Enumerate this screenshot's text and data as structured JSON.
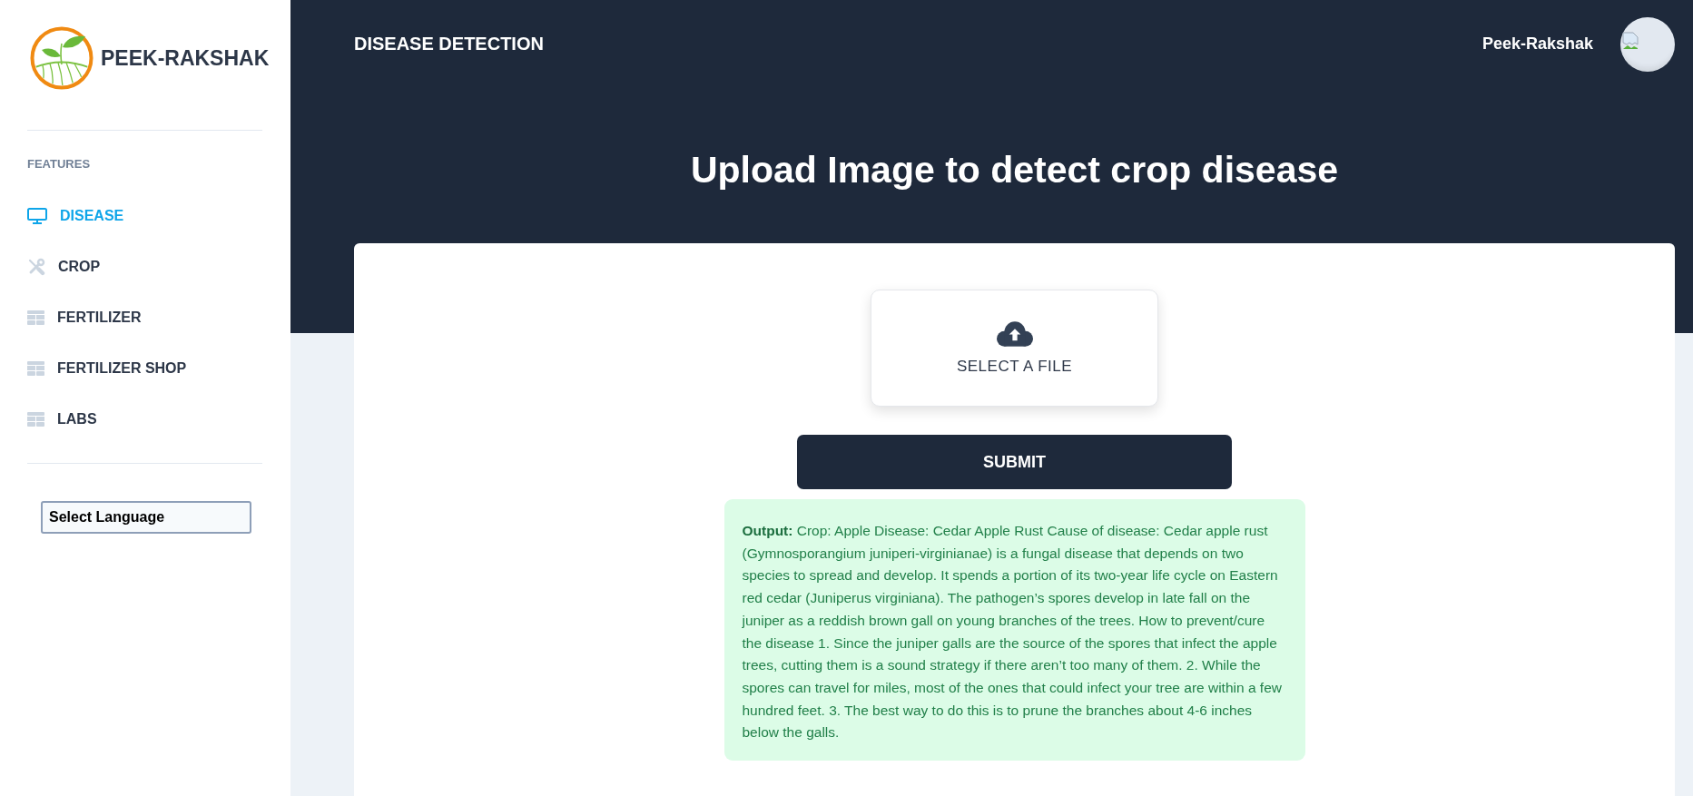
{
  "sidebar": {
    "brand": "PEEK-RAKSHAK",
    "section_title": "FEATURES",
    "items": [
      {
        "label": "DISEASE",
        "selected": true
      },
      {
        "label": "CROP",
        "selected": false
      },
      {
        "label": "FERTILIZER",
        "selected": false
      },
      {
        "label": "FERTILIZER SHOP",
        "selected": false
      },
      {
        "label": "LABS",
        "selected": false
      }
    ],
    "language_select": {
      "value": "Select Language"
    }
  },
  "header": {
    "title": "DISEASE DETECTION",
    "user_name": "Peek-Rakshak"
  },
  "upload": {
    "heading": "Upload Image to detect crop disease",
    "file_button": "SELECT A FILE",
    "submit_button": "SUBMIT",
    "output": "**Output:** Crop: Apple Disease: Cedar Apple Rust Cause of disease: Cedar apple rust (Gymnosporangium juniperi-virginianae) is a fungal disease that depends on two species to spread and develop. It spends a portion of its two-year life cycle on Eastern red cedar (Juniperus virginiana). The pathogen’s spores develop in late fall on the juniper as a reddish brown gall on young branches of the trees. How to prevent/cure the disease 1. Since the juniper galls are the source of the spores that infect the apple trees, cutting them is a sound strategy if there aren’t too many of them. 2. While the spores can travel for miles, most of the ones that could infect your tree are within a few hundred feet. 3. The best way to do this is to prune the branches about 4-6 inches below the galls."
  }
}
